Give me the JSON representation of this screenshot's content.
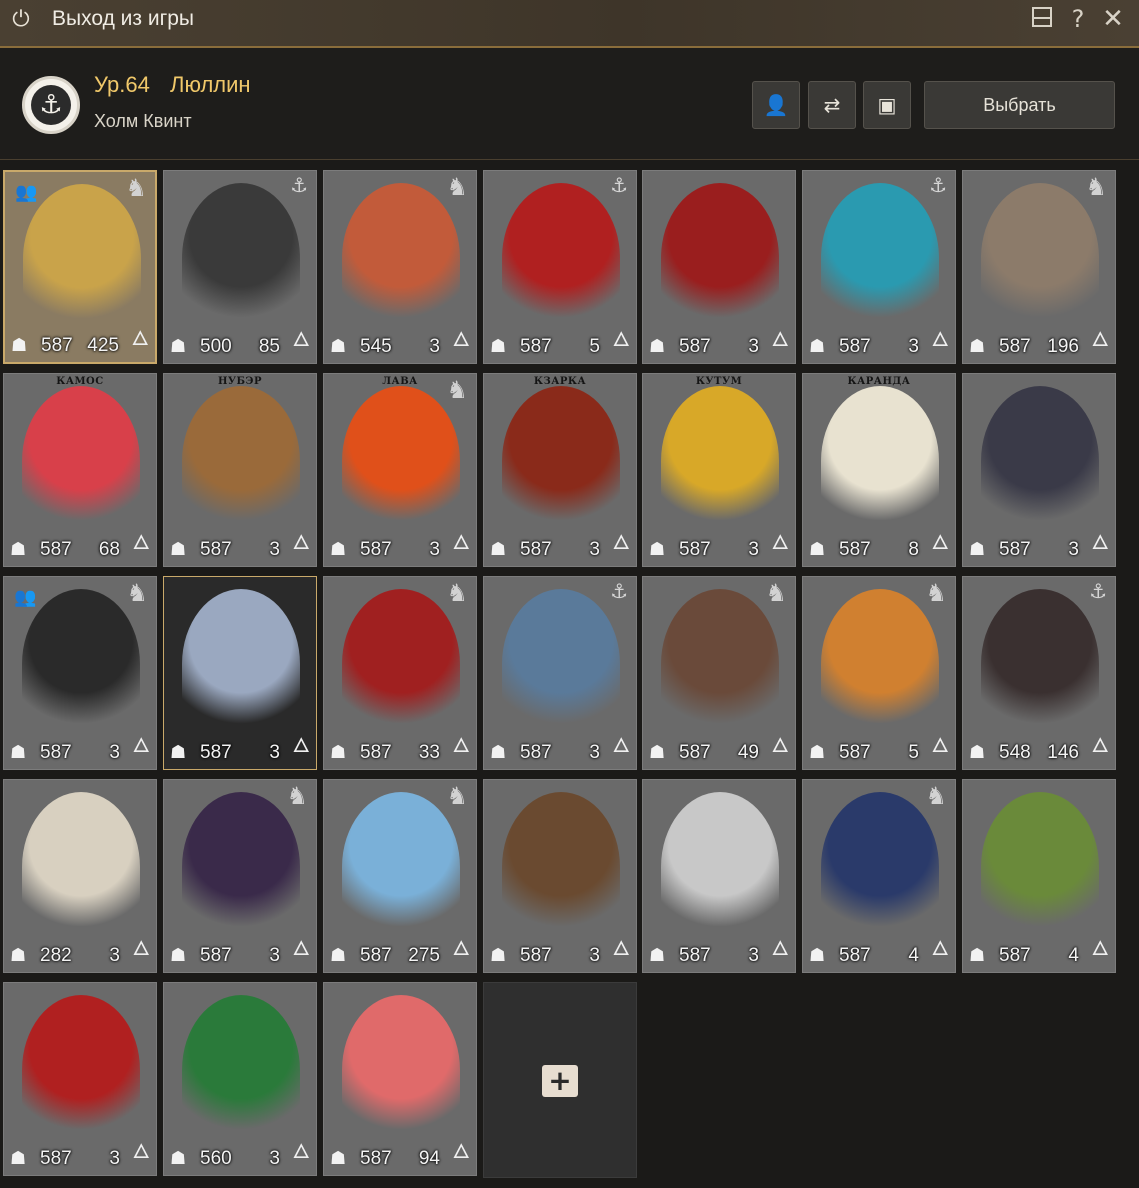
{
  "window": {
    "title": "Выход из игры"
  },
  "header": {
    "level": "Ур.64",
    "character_name": "Люллин",
    "region": "Холм Квинт",
    "select_label": "Выбрать"
  },
  "colors": {
    "accent_gold": "#f0c86a",
    "card_bg": "#6a6a6a",
    "selected_border": "#c9a96a"
  },
  "cards": [
    {
      "caption": "",
      "energy": "587",
      "count": "425",
      "badge": "horse",
      "group": true,
      "portrait": "#c9a34a"
    },
    {
      "caption": "",
      "energy": "500",
      "count": "85",
      "badge": "anchor",
      "group": false,
      "portrait": "#3a3a3a"
    },
    {
      "caption": "",
      "energy": "545",
      "count": "3",
      "badge": "horse",
      "group": false,
      "portrait": "#c25b3a"
    },
    {
      "caption": "",
      "energy": "587",
      "count": "5",
      "badge": "anchor",
      "group": false,
      "portrait": "#b02020"
    },
    {
      "caption": "",
      "energy": "587",
      "count": "3",
      "badge": "",
      "group": false,
      "portrait": "#9a1e1e"
    },
    {
      "caption": "",
      "energy": "587",
      "count": "3",
      "badge": "anchor",
      "group": false,
      "portrait": "#2a9ab0"
    },
    {
      "caption": "",
      "energy": "587",
      "count": "196",
      "badge": "horse",
      "group": false,
      "portrait": "#8c7b6a"
    },
    {
      "caption": "КАМОС",
      "energy": "587",
      "count": "68",
      "badge": "",
      "group": false,
      "portrait": "#d8404a"
    },
    {
      "caption": "НУБЭР",
      "energy": "587",
      "count": "3",
      "badge": "",
      "group": false,
      "portrait": "#9a6a3a"
    },
    {
      "caption": "ЛАВА",
      "energy": "587",
      "count": "3",
      "badge": "horse",
      "group": false,
      "portrait": "#e0501a"
    },
    {
      "caption": "КЗАРКА",
      "energy": "587",
      "count": "3",
      "badge": "",
      "group": false,
      "portrait": "#8a2a1a"
    },
    {
      "caption": "КУТУМ",
      "energy": "587",
      "count": "3",
      "badge": "",
      "group": false,
      "portrait": "#d8a828"
    },
    {
      "caption": "КАРАНДА",
      "energy": "587",
      "count": "8",
      "badge": "",
      "group": false,
      "portrait": "#e8e2d0"
    },
    {
      "caption": "",
      "energy": "587",
      "count": "3",
      "badge": "",
      "group": false,
      "portrait": "#3a3a48"
    },
    {
      "caption": "",
      "energy": "587",
      "count": "3",
      "badge": "horse",
      "group": true,
      "portrait": "#2a2a2a"
    },
    {
      "caption": "",
      "energy": "587",
      "count": "3",
      "badge": "",
      "group": false,
      "portrait": "#9aa8c0"
    },
    {
      "caption": "",
      "energy": "587",
      "count": "33",
      "badge": "horse",
      "group": false,
      "portrait": "#a02020"
    },
    {
      "caption": "",
      "energy": "587",
      "count": "3",
      "badge": "anchor",
      "group": false,
      "portrait": "#5a7a9a"
    },
    {
      "caption": "",
      "energy": "587",
      "count": "49",
      "badge": "horse",
      "group": false,
      "portrait": "#6a4a3a"
    },
    {
      "caption": "",
      "energy": "587",
      "count": "5",
      "badge": "horse",
      "group": false,
      "portrait": "#d08030"
    },
    {
      "caption": "",
      "energy": "548",
      "count": "146",
      "badge": "anchor",
      "group": false,
      "portrait": "#3a3030"
    },
    {
      "caption": "",
      "energy": "282",
      "count": "3",
      "badge": "",
      "group": false,
      "portrait": "#d8d0c0"
    },
    {
      "caption": "",
      "energy": "587",
      "count": "3",
      "badge": "horse",
      "group": false,
      "portrait": "#3a2a4a"
    },
    {
      "caption": "",
      "energy": "587",
      "count": "275",
      "badge": "horse",
      "group": false,
      "portrait": "#7ab0d8"
    },
    {
      "caption": "",
      "energy": "587",
      "count": "3",
      "badge": "",
      "group": false,
      "portrait": "#6a4a30"
    },
    {
      "caption": "",
      "energy": "587",
      "count": "3",
      "badge": "",
      "group": false,
      "portrait": "#c8c8c8"
    },
    {
      "caption": "",
      "energy": "587",
      "count": "4",
      "badge": "horse",
      "group": false,
      "portrait": "#2a3a6a"
    },
    {
      "caption": "",
      "energy": "587",
      "count": "4",
      "badge": "",
      "group": false,
      "portrait": "#6a8a3a"
    },
    {
      "caption": "",
      "energy": "587",
      "count": "3",
      "badge": "",
      "group": false,
      "portrait": "#b02020"
    },
    {
      "caption": "",
      "energy": "560",
      "count": "3",
      "badge": "",
      "group": false,
      "portrait": "#2a7a3a"
    },
    {
      "caption": "",
      "energy": "587",
      "count": "94",
      "badge": "",
      "group": false,
      "portrait": "#e06a6a"
    }
  ],
  "add_slot": {
    "plus_label": "+"
  }
}
